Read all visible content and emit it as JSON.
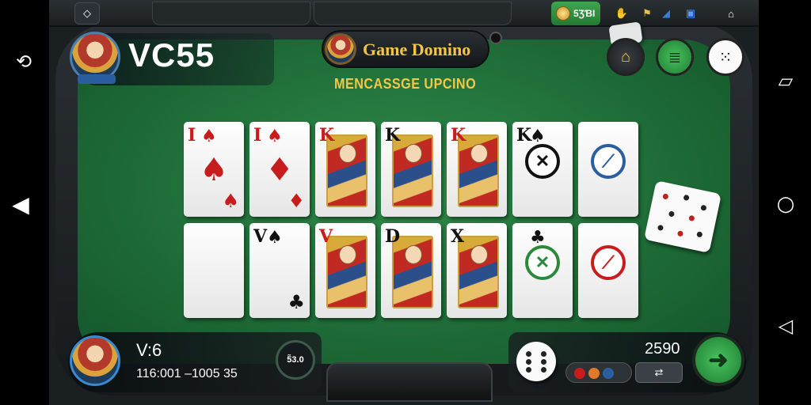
{
  "header": {
    "player_name": "VC55",
    "avatar_badge": "",
    "title": "Game Domino",
    "subtitle": "MENCASSGE UPCINO",
    "coins": "5ƷƁI"
  },
  "bottom": {
    "player_name": "V:6",
    "score_line": "116:001 –1005 35",
    "timer_text": "5̃3.0",
    "right_value": "2590"
  },
  "cards": {
    "top": [
      {
        "rank": "I",
        "suit": "♠",
        "color": "red",
        "big": "♠",
        "br": "♠"
      },
      {
        "rank": "I",
        "suit": "♠",
        "color": "red",
        "big": "♦",
        "br": "♦"
      },
      {
        "rank": "K",
        "suit": "",
        "color": "red",
        "face": true
      },
      {
        "rank": "K",
        "suit": "",
        "color": "blk",
        "face": true
      },
      {
        "rank": "K",
        "suit": "",
        "color": "red",
        "face": true
      },
      {
        "rank": "K",
        "suit": "♠",
        "color": "blk",
        "emblem": "✕",
        "emblem_color": "#111"
      },
      {
        "rank": "",
        "suit": "",
        "color": "blk",
        "emblem": "⟋",
        "emblem_color": "#2a5ea0"
      }
    ],
    "bottom": [
      {
        "rank": "",
        "suit": "",
        "color": "blk"
      },
      {
        "rank": "V",
        "suit": "♠",
        "color": "blk",
        "br": "♣"
      },
      {
        "rank": "V",
        "suit": "",
        "color": "red",
        "face": true
      },
      {
        "rank": "D",
        "suit": "",
        "color": "blk",
        "face": true
      },
      {
        "rank": "X",
        "suit": "",
        "color": "blk",
        "face": true
      },
      {
        "rank": "",
        "suit": "♣",
        "color": "blk",
        "emblem": "✕",
        "emblem_color": "#2a8a3a"
      },
      {
        "rank": "",
        "suit": "",
        "color": "red",
        "emblem": "⟋",
        "emblem_color": "#c81d1d"
      }
    ]
  },
  "icons": {
    "back": "diamond-back-icon",
    "house": "house-icon",
    "stack": "chip-stack-icon",
    "dice": "dice-icon",
    "camera": "camera-icon"
  },
  "colors": {
    "felt": "#1f6d38",
    "title_gold": "#f3c64a",
    "accent_green": "#3fa54e"
  }
}
